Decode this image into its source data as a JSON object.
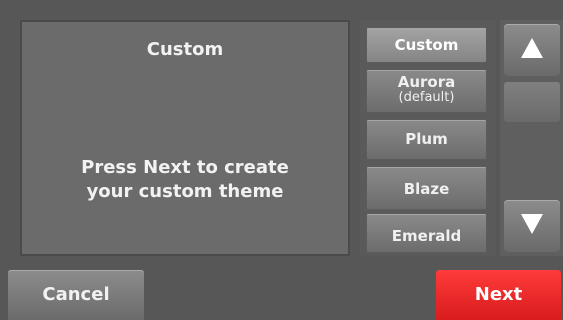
{
  "preview": {
    "title": "Custom",
    "message_line1": "Press Next to create",
    "message_line2": "your custom theme"
  },
  "themes": [
    {
      "label": "Custom",
      "selected": true
    },
    {
      "label": "Aurora",
      "sublabel": "(default)",
      "selected": false
    },
    {
      "label": "Plum",
      "selected": false
    },
    {
      "label": "Blaze",
      "selected": false
    },
    {
      "label": "Emerald",
      "selected": false
    }
  ],
  "scroll": {
    "up_icon": "arrow-up-icon",
    "down_icon": "arrow-down-icon"
  },
  "footer": {
    "cancel_label": "Cancel",
    "next_label": "Next"
  },
  "colors": {
    "background": "#575757",
    "panel": "#6b6b6b",
    "button": "#7c7c7c",
    "next_button": "#e82828",
    "text": "#f2f2f2"
  }
}
